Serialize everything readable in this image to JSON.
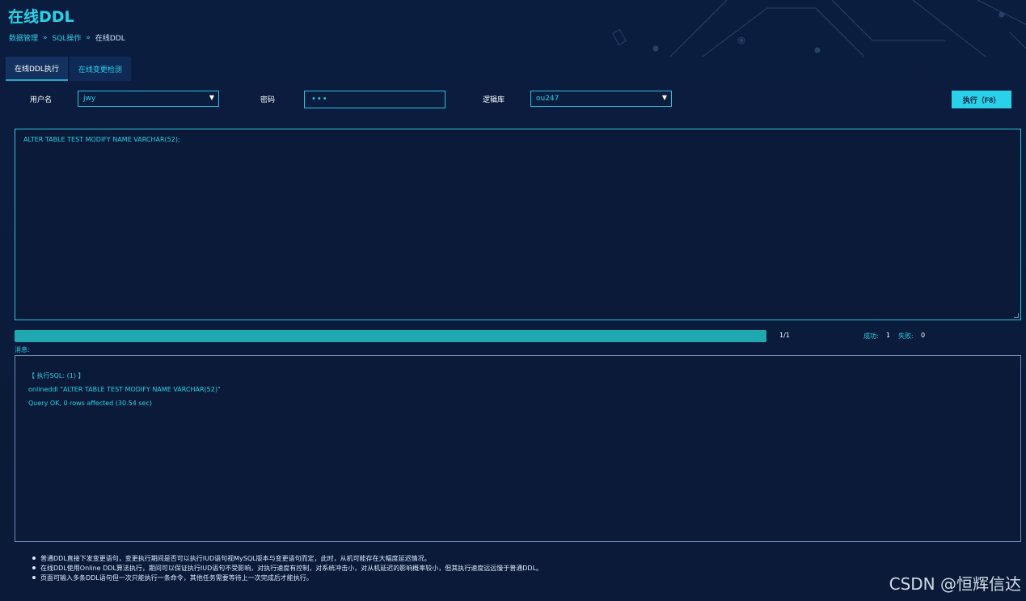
{
  "page": {
    "title": "在线DDL"
  },
  "breadcrumb": {
    "items": [
      "数据管理",
      "SQL操作"
    ],
    "current": "在线DDL",
    "separator": "»"
  },
  "tabs": [
    {
      "label": "在线DDL执行",
      "active": true
    },
    {
      "label": "在线变更检测",
      "active": false
    }
  ],
  "form": {
    "username_label": "用户名",
    "username_value": "jwy",
    "password_label": "密码",
    "password_value": "•••",
    "logic_db_label": "逻辑库",
    "logic_db_value": "ou247",
    "run_button_label": "执行（F8）"
  },
  "editor": {
    "sql": "ALTER TABLE TEST MODIFY NAME VARCHAR(52);"
  },
  "progress": {
    "fraction": 1.0,
    "count_text": "1/1",
    "success_label": "成功:",
    "success_value": "1",
    "fail_label": "失败:",
    "fail_value": "0"
  },
  "messages": {
    "label": "消息:",
    "lines": [
      "【 执行SQL:  (1) 】",
      "onlineddl \"ALTER TABLE TEST MODIFY NAME VARCHAR(52)\"",
      "Query OK, 0 rows affected (30.54 sec)"
    ]
  },
  "notes": [
    "普通DDL直接下发变更语句，变更执行期间是否可以执行IUD语句视MySQL版本与变更语句而定，此时，从机可能存在大幅度延迟情况。",
    "在线DDL使用Online DDL算法执行，期间可以保证执行IUD语句不受影响，对执行速度有控制，对系统冲击小，对从机延迟的影响概率较小，但其执行速度远远慢于普通DDL。",
    "页面可输入多条DDL语句但一次只能执行一条命令，其他任务需要等待上一次完成后才能执行。"
  ],
  "watermark": "CSDN @恒辉信达",
  "colors": {
    "background": "#0b1a3a",
    "accent": "#29d2e8",
    "progress": "#1fa8b0"
  },
  "icons": {
    "caret": "caret-down-icon"
  }
}
